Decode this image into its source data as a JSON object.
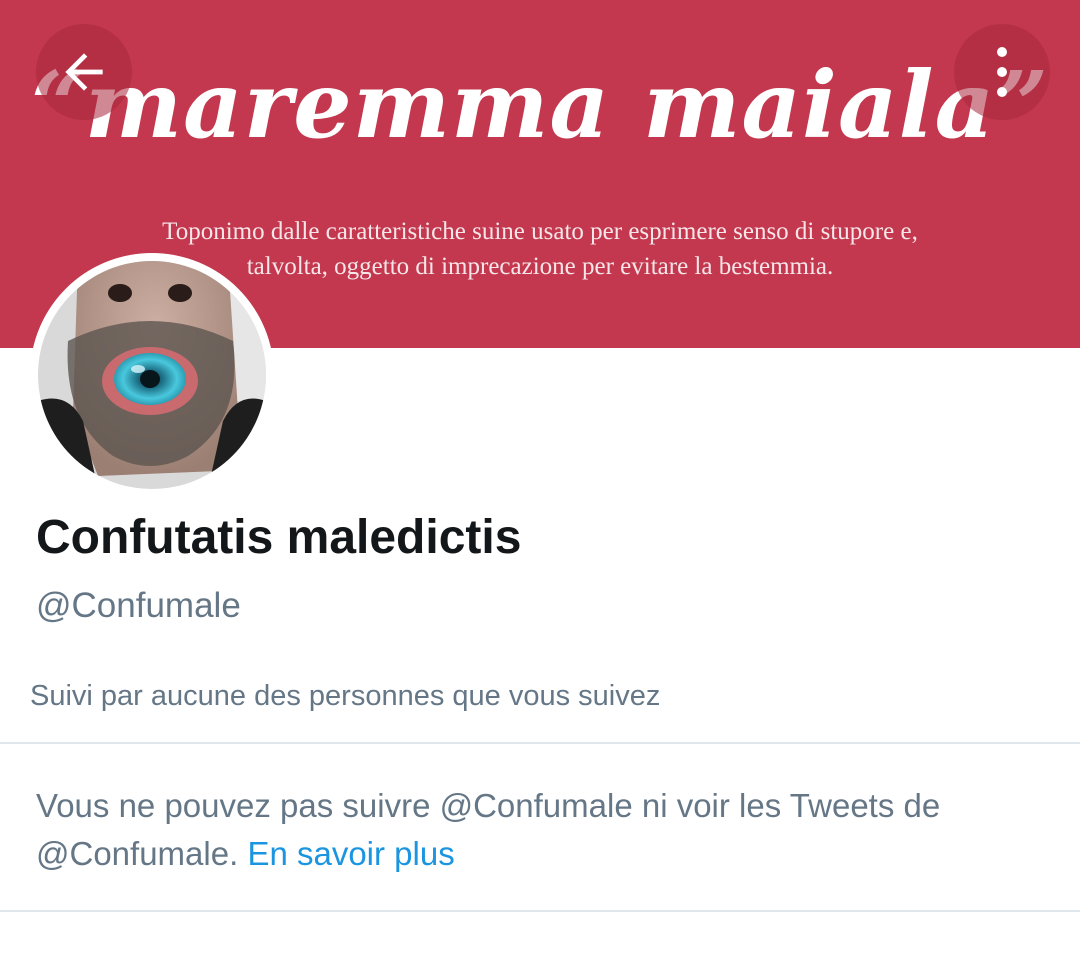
{
  "banner": {
    "title": "“maremma maiala”",
    "subtitle": "Toponimo dalle caratteristiche suine usato per esprimere senso di stupore e, talvolta, oggetto di imprecazione per evitare la bestemmia.",
    "background_color": "#c3384e"
  },
  "top_bar": {
    "back_icon": "arrow-left-icon",
    "more_icon": "more-vertical-icon"
  },
  "profile": {
    "display_name": "Confutatis maledictis",
    "handle": "@Confumale",
    "followed_by": "Suivi par aucune des personnes que vous suivez"
  },
  "blocked_notice": {
    "text": "Vous ne pouvez pas suivre @Confumale ni voir les Tweets de @Confumale.",
    "link_label": "En savoir plus",
    "link_color": "#1b95e0"
  }
}
